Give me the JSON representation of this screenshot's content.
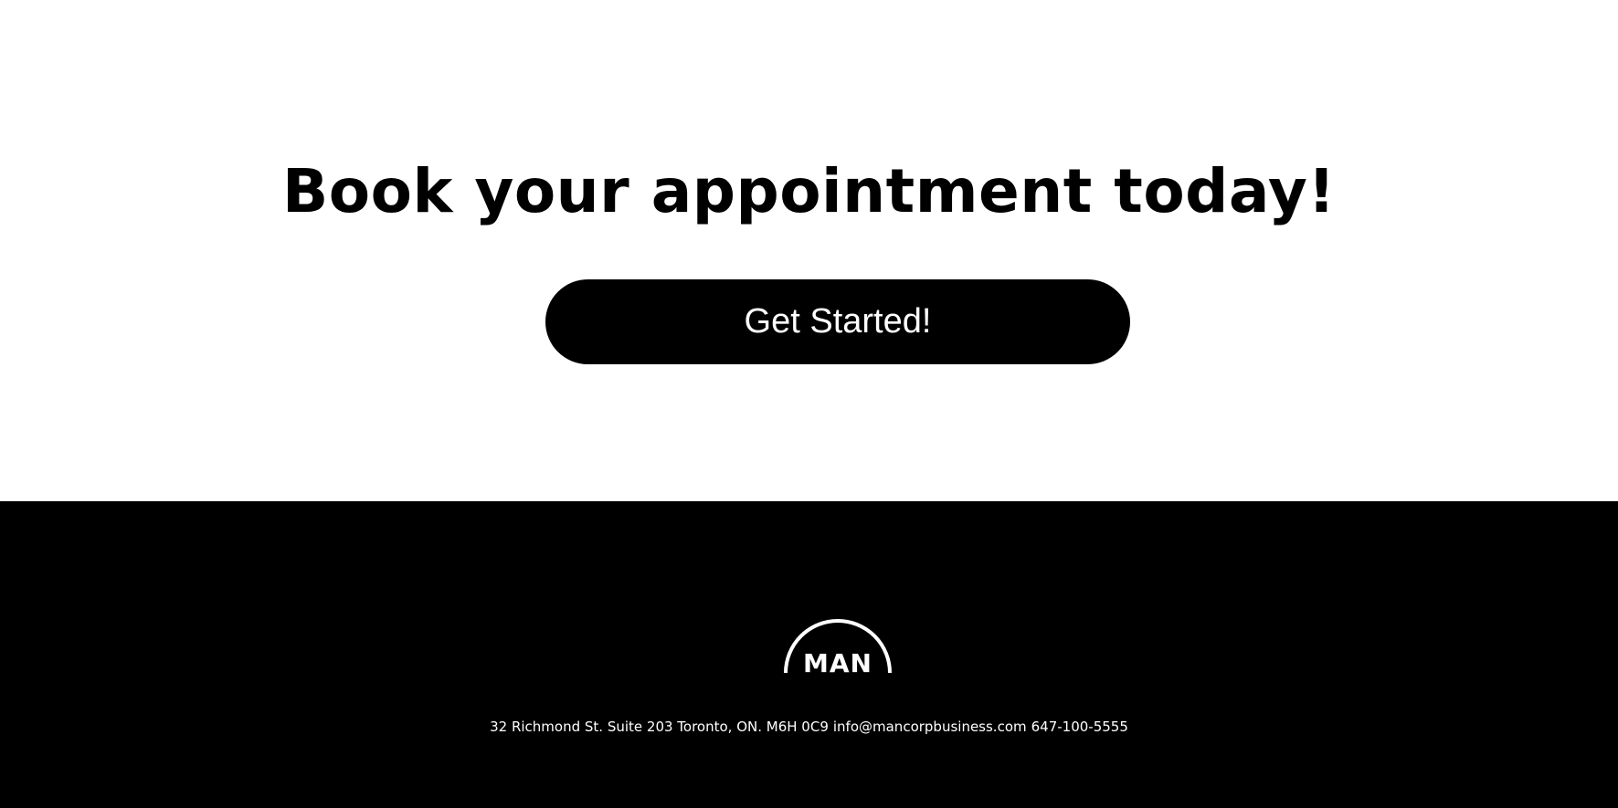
{
  "hero": {
    "headline": "Book your appointment today!",
    "cta_label": "Get Started!"
  },
  "footer": {
    "logo_text": "MAN",
    "address": "32 Richmond St. Suite 203 Toronto, ON. M6H 0C9",
    "email": "info@mancorpbusiness.com",
    "phone": "647-100-5555"
  },
  "colors": {
    "background": "#ffffff",
    "footer_background": "#000000",
    "button_background": "#000000",
    "button_text": "#ffffff",
    "text": "#000000",
    "footer_text": "#ffffff"
  },
  "icons": {
    "logo": "man-logo-icon"
  }
}
